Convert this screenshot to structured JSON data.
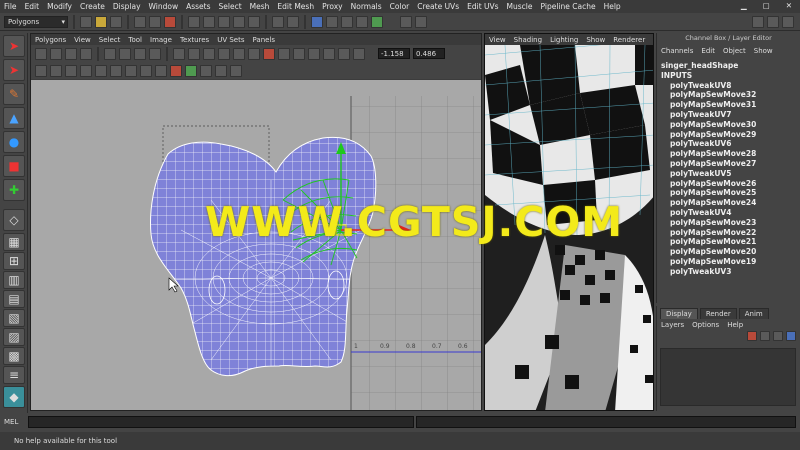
{
  "menubar": {
    "items": [
      "File",
      "Edit",
      "Modify",
      "Create",
      "Display",
      "Window",
      "Assets",
      "Select",
      "Mesh",
      "Edit Mesh",
      "Proxy",
      "Normals",
      "Color",
      "Create UVs",
      "Edit UVs",
      "Muscle",
      "Pipeline Cache",
      "Help"
    ]
  },
  "statusline": {
    "mode": "Polygons"
  },
  "uv_editor": {
    "menu": [
      "Polygons",
      "View",
      "Select",
      "Tool",
      "Image",
      "Textures",
      "UV Sets",
      "Panels"
    ],
    "field_u": "-1.158",
    "field_v": "0.486",
    "grid_labels": [
      "1",
      "0.9",
      "0.8",
      "0.7",
      "0.6"
    ]
  },
  "viewport": {
    "menu": [
      "View",
      "Shading",
      "Lighting",
      "Show",
      "Renderer"
    ]
  },
  "channel_box": {
    "title": "Channel Box / Layer Editor",
    "menu": [
      "Channels",
      "Edit",
      "Object",
      "Show"
    ],
    "shape": "singer_headShape",
    "inputs_label": "INPUTS",
    "inputs": [
      "polyTweakUV8",
      "polyMapSewMove32",
      "polyMapSewMove31",
      "polyTweakUV7",
      "polyMapSewMove30",
      "polyMapSewMove29",
      "polyTweakUV6",
      "polyMapSewMove28",
      "polyMapSewMove27",
      "polyTweakUV5",
      "polyMapSewMove26",
      "polyMapSewMove25",
      "polyMapSewMove24",
      "polyTweakUV4",
      "polyMapSewMove23",
      "polyMapSewMove22",
      "polyMapSewMove21",
      "polyMapSewMove20",
      "polyMapSewMove19",
      "polyTweakUV3"
    ]
  },
  "layer_editor": {
    "tabs": [
      "Display",
      "Render",
      "Anim"
    ],
    "menu": [
      "Layers",
      "Options",
      "Help"
    ]
  },
  "command_line": {
    "label": "MEL"
  },
  "help_line": {
    "text": "No help available for this tool"
  },
  "watermark": {
    "text": "WWW.CGTSJ.COM"
  },
  "colors": {
    "uv_shell": "#7f82d8",
    "uv_background": "#a9a9a9",
    "manipulator_red": "#e8231c",
    "manipulator_green": "#1ec81e",
    "watermark": "#f3ea1a"
  }
}
